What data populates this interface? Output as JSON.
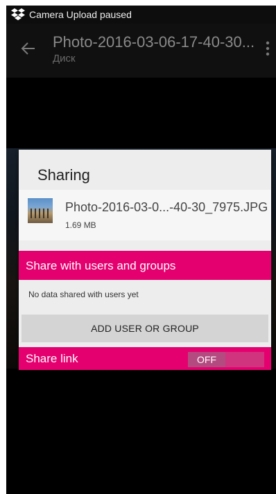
{
  "status_bar": {
    "app_icon": "dropbox-icon",
    "text": "Camera Upload paused"
  },
  "app_bar": {
    "title": "Photo-2016-03-06-17-40-30...",
    "subtitle": "Диск",
    "back_icon": "arrow-left-icon",
    "overflow_icon": "more-vert-icon"
  },
  "dialog": {
    "title": "Sharing",
    "file": {
      "name": "Photo-2016-03-0...-40-30_7975.JPG",
      "size": "1.69 MB",
      "thumbnail_icon": "photo-thumbnail"
    },
    "share_users": {
      "header": "Share with users and groups",
      "empty_text": "No data shared with users yet",
      "add_button": "ADD USER OR GROUP"
    },
    "share_link": {
      "label": "Share link",
      "toggle_state": "OFF"
    }
  },
  "colors": {
    "accent": "#e5006f",
    "dialog_bg": "#ededed",
    "button_bg": "#d4d4d4"
  }
}
